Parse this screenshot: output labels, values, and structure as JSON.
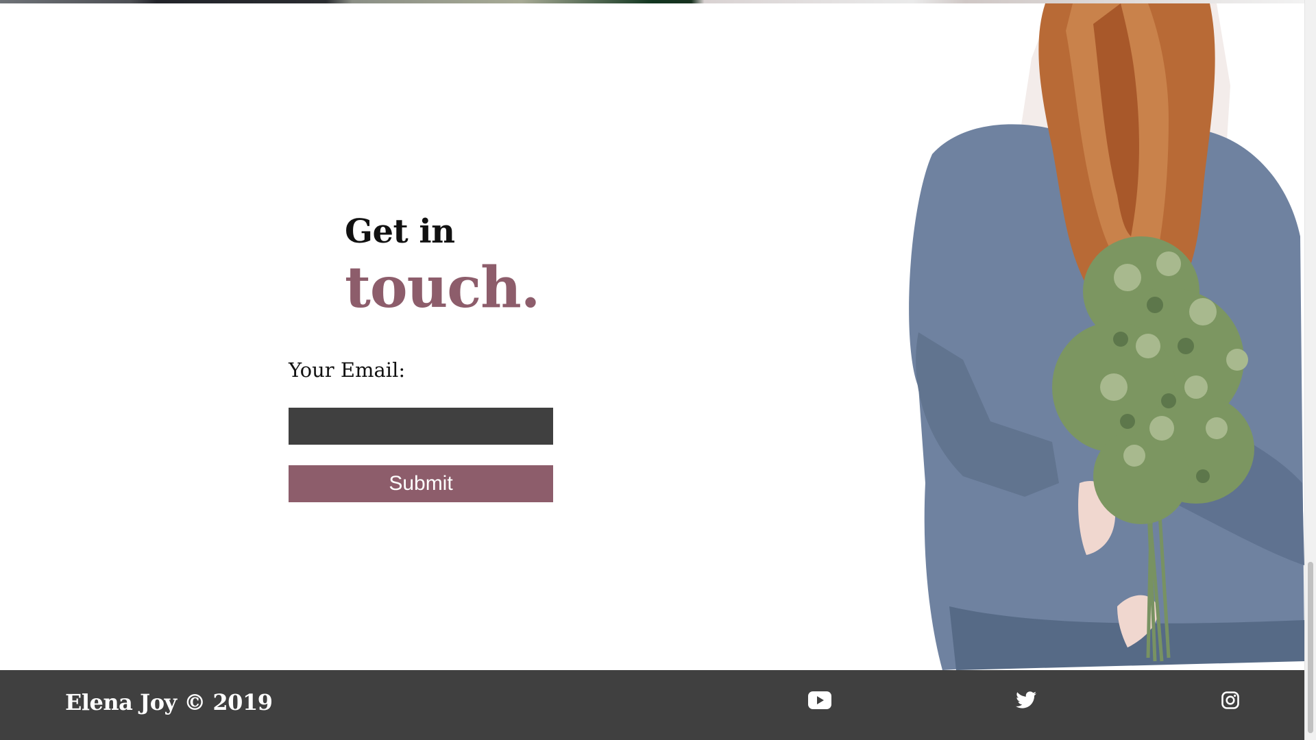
{
  "contact": {
    "heading_line1": "Get in",
    "heading_line2": "touch.",
    "email_label": "Your Email:",
    "email_value": "",
    "submit_label": "Submit"
  },
  "footer": {
    "copyright": "Elena Joy © 2019",
    "social_icons": [
      "youtube-icon",
      "twitter-icon",
      "instagram-icon"
    ]
  },
  "colors": {
    "accent": "#8d5d6b",
    "dark": "#404040",
    "text": "#111111",
    "background": "#ffffff"
  }
}
